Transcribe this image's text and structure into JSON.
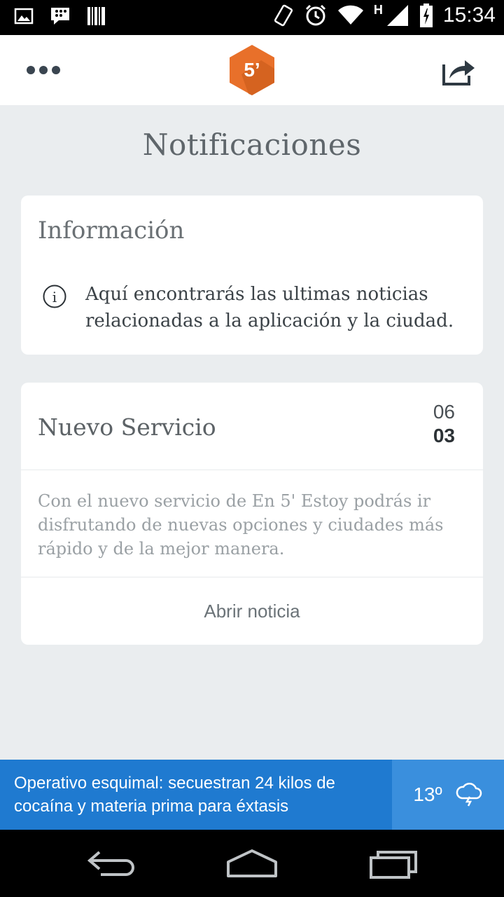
{
  "status_bar": {
    "time": "15:34",
    "network": "H",
    "icons": [
      "image-icon",
      "bbm-icon",
      "barcode-icon",
      "vibrate-icon",
      "alarm-icon",
      "wifi-icon",
      "signal-icon",
      "battery-icon"
    ]
  },
  "app_bar": {
    "logo_text": "5’",
    "logo_color": "#e8702a",
    "menu_icon": "more-dots-icon",
    "share_icon": "share-icon"
  },
  "page": {
    "title": "Notificaciones"
  },
  "info_card": {
    "title": "Información",
    "icon": "info-icon",
    "text": "Aquí encontrarás las ultimas noticias relacionadas a la aplicación y la ciudad."
  },
  "news_card": {
    "title": "Nuevo Servicio",
    "month": "06",
    "day": "03",
    "body": "Con el nuevo servicio de En 5' Estoy podrás ir disfrutando de nuevas opciones y ciudades más rápido y de la mejor manera.",
    "action_label": "Abrir noticia"
  },
  "ticker": {
    "headline": "Operativo esquimal: secuestran 24 kilos de cocaína y materia prima para éxtasis",
    "temperature": "13º",
    "weather_icon": "storm-cloud-icon",
    "bg_color": "#1f7ad0"
  },
  "nav_bar": {
    "buttons": [
      "back-icon",
      "home-icon",
      "recents-icon"
    ]
  }
}
